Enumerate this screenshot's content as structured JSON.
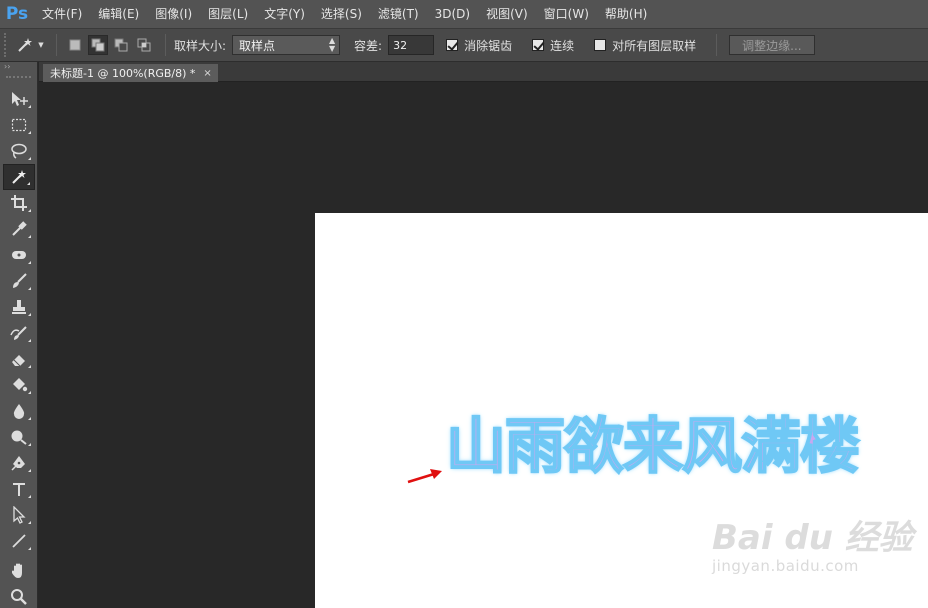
{
  "app": {
    "logo": "Ps"
  },
  "menu": [
    "文件(F)",
    "编辑(E)",
    "图像(I)",
    "图层(L)",
    "文字(Y)",
    "选择(S)",
    "滤镜(T)",
    "3D(D)",
    "视图(V)",
    "窗口(W)",
    "帮助(H)"
  ],
  "options": {
    "sample_size_label": "取样大小:",
    "sample_size_value": "取样点",
    "tolerance_label": "容差:",
    "tolerance_value": "32",
    "anti_alias_label": "消除锯齿",
    "anti_alias_checked": true,
    "contiguous_label": "连续",
    "contiguous_checked": true,
    "all_layers_label": "对所有图层取样",
    "all_layers_checked": false,
    "refine_edge_label": "调整边缘..."
  },
  "toolbar": {
    "collapse_glyph": "››",
    "tools": [
      "move-tool",
      "marquee-tool",
      "lasso-tool",
      "magic-wand-tool",
      "crop-tool",
      "eyedropper-tool",
      "healing-brush-tool",
      "brush-tool",
      "clone-stamp-tool",
      "history-brush-tool",
      "eraser-tool",
      "paint-bucket-tool",
      "blur-tool",
      "dodge-tool",
      "pen-tool",
      "type-tool",
      "path-selection-tool",
      "line-tool",
      "hand-tool",
      "zoom-tool"
    ],
    "active_tool": "magic-wand-tool"
  },
  "document": {
    "tab_title": "未标题-1 @ 100%(RGB/8) *",
    "close_glyph": "×",
    "canvas_text": "山雨欲来风满楼",
    "arrow_color": "#e01010"
  },
  "watermark": {
    "logo_text": "Bai du 经验",
    "url": "jingyan.baidu.com"
  }
}
